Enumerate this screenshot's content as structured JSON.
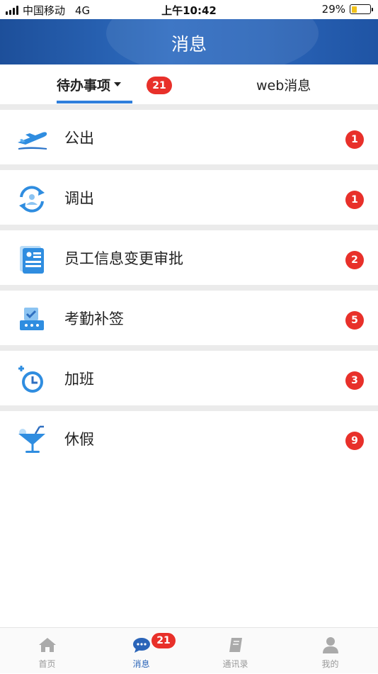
{
  "status_bar": {
    "carrier": "中国移动",
    "network": "4G",
    "time": "上午10:42",
    "battery": "29%"
  },
  "header": {
    "title": "消息"
  },
  "tabs": {
    "todo": {
      "label": "待办事项",
      "badge": "21",
      "active": true
    },
    "web": {
      "label": "web消息"
    }
  },
  "items": [
    {
      "title": "公出",
      "count": "1",
      "icon": "airplane-icon"
    },
    {
      "title": "调出",
      "count": "1",
      "icon": "transfer-person-icon"
    },
    {
      "title": "员工信息变更审批",
      "count": "2",
      "icon": "id-card-icon"
    },
    {
      "title": "考勤补签",
      "count": "5",
      "icon": "attendance-icon"
    },
    {
      "title": "加班",
      "count": "3",
      "icon": "clock-plus-icon"
    },
    {
      "title": "休假",
      "count": "9",
      "icon": "cocktail-icon"
    }
  ],
  "bottom_nav": {
    "home": {
      "label": "首页",
      "icon": "home-icon"
    },
    "messages": {
      "label": "消息",
      "icon": "chat-bubble-icon",
      "badge": "21",
      "active": true
    },
    "contacts": {
      "label": "通讯录",
      "icon": "address-book-icon"
    },
    "mine": {
      "label": "我的",
      "icon": "person-icon"
    }
  },
  "colors": {
    "header": "#2a64b8",
    "accent": "#2f7fdc",
    "badge": "#e8302a"
  }
}
